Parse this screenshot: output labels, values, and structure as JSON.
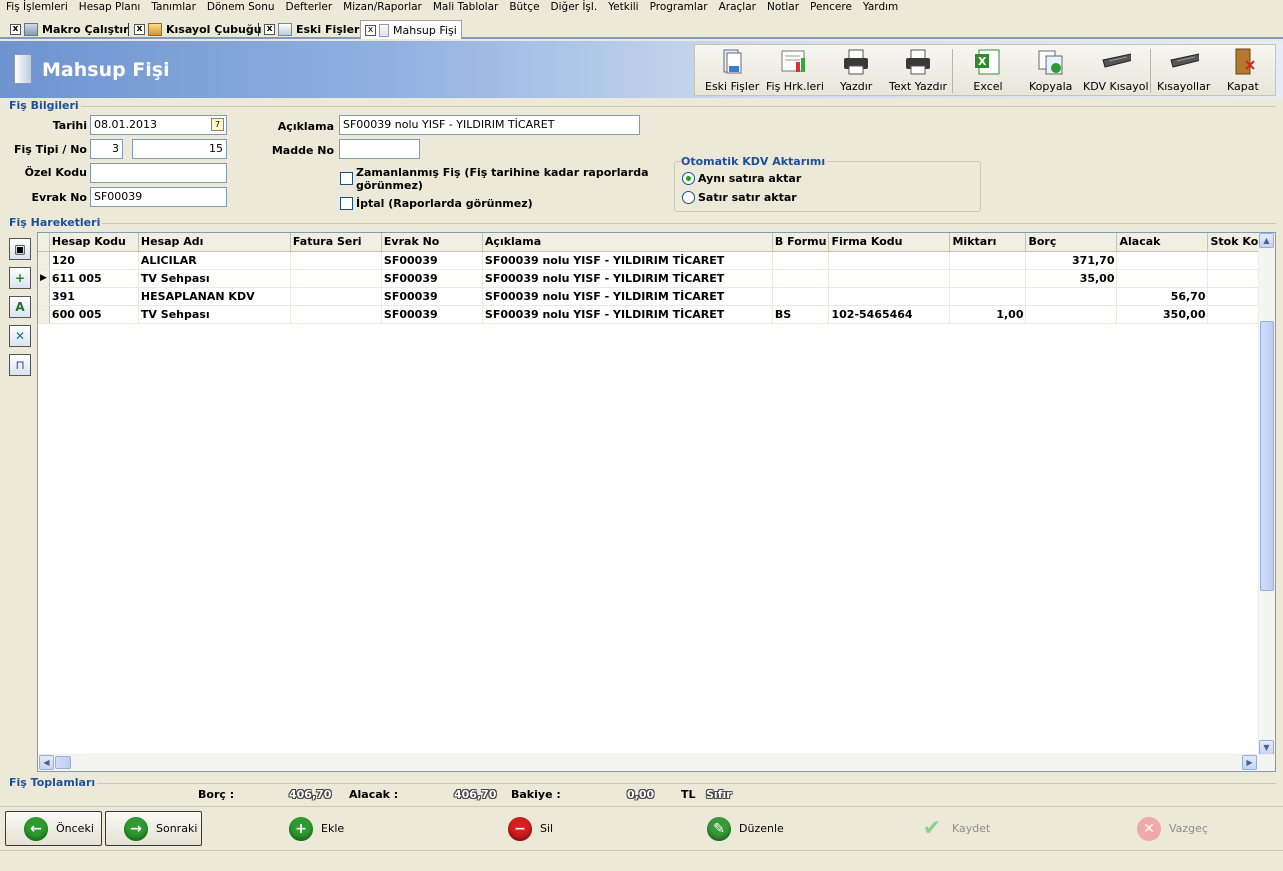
{
  "menu": [
    "Fiş İşlemleri",
    "Hesap Planı",
    "Tanımlar",
    "Dönem Sonu",
    "Defterler",
    "Mizan/Raporlar",
    "Mali Tablolar",
    "Bütçe",
    "Diğer İşl.",
    "Yetkili",
    "Programlar",
    "Araçlar",
    "Notlar",
    "Pencere",
    "Yardım"
  ],
  "tabs": [
    {
      "label": "Makro Çalıştır",
      "close": "x"
    },
    {
      "label": "Kısayol Çubuğu",
      "close": "x"
    },
    {
      "label": "Eski Fişler",
      "close": "x"
    },
    {
      "label": "Mahsup Fişi",
      "close": "x"
    }
  ],
  "header": {
    "title": "Mahsup Fişi"
  },
  "toolbar": {
    "eski_fisler": "Eski Fişler",
    "fis_hrk": "Fiş Hrk.leri",
    "yazdir": "Yazdır",
    "text_yazdir": "Text Yazdır",
    "excel": "Excel",
    "kopyala": "Kopyala",
    "kdv_kisayol": "KDV Kısayol",
    "kisayollar": "Kısayollar",
    "kapat": "Kapat"
  },
  "fis_bilgileri": {
    "title": "Fiş Bilgileri",
    "tarihi_label": "Tarihi",
    "tarihi": "08.01.2013",
    "calendar_glyph": "7",
    "fis_tipi_label": "Fiş Tipi / No",
    "fis_tipi": "3",
    "fis_no": "15",
    "ozel_kodu_label": "Özel Kodu",
    "ozel_kodu": "",
    "evrak_no_label": "Evrak No",
    "evrak_no": "SF00039",
    "aciklama_label": "Açıklama",
    "aciklama": "SF00039 nolu YISF - YILDIRIM TİCARET",
    "madde_no_label": "Madde No",
    "madde_no": "",
    "zamanlanmis_line1": "Zamanlanmış Fiş (Fiş tarihine kadar raporlarda",
    "zamanlanmis_line2": "görünmez)",
    "iptal": "İptal (Raporlarda görünmez)"
  },
  "kdv": {
    "title": "Otomatik KDV Aktarımı",
    "ayni_satira": "Aynı satıra aktar",
    "satir_satir": "Satır satır aktar",
    "selected": "ayni_satira"
  },
  "hareketler": {
    "title": "Fiş Hareketleri",
    "columns": [
      "Hesap Kodu",
      "Hesap Adı",
      "Fatura Seri",
      "Evrak No",
      "Açıklama",
      "B Formu",
      "Firma Kodu",
      "Miktarı",
      "Borç",
      "Alacak",
      "Stok Ko"
    ],
    "rows": [
      [
        "120",
        "ALICILAR",
        "",
        "SF00039",
        "SF00039 nolu YISF - YILDIRIM TİCARET",
        "",
        "",
        "",
        "371,70",
        "",
        ""
      ],
      [
        "611 005",
        "TV Sehpası",
        "",
        "SF00039",
        "SF00039 nolu YISF - YILDIRIM TİCARET",
        "",
        "",
        "",
        "35,00",
        "",
        ""
      ],
      [
        "391",
        "HESAPLANAN KDV",
        "",
        "SF00039",
        "SF00039 nolu YISF - YILDIRIM TİCARET",
        "",
        "",
        "",
        "",
        "56,70",
        ""
      ],
      [
        "600 005",
        "TV Sehpası",
        "",
        "SF00039",
        "SF00039 nolu YISF - YILDIRIM TİCARET",
        "BS",
        "102-5465464",
        "1,00",
        "",
        "350,00",
        ""
      ]
    ],
    "current_row": 1,
    "row_indicator": "▶"
  },
  "toplamlar": {
    "title": "Fiş Toplamları",
    "borc_label": "Borç :",
    "borc": "406,70",
    "alacak_label": "Alacak :",
    "alacak": "406,70",
    "bakiye_label": "Bakiye :",
    "bakiye": "0,00",
    "currency": "TL",
    "sifir": "Sıfır"
  },
  "buttons": {
    "onceki": "Önceki",
    "sonraki": "Sonraki",
    "ekle": "Ekle",
    "sil": "Sil",
    "duzenle": "Düzenle",
    "kaydet": "Kaydet",
    "vazgec": "Vazgeç"
  },
  "colors": {
    "accent": "#1e4f9e",
    "header_gradient": "#6e93cf",
    "kdv_radio": "#21a121"
  }
}
